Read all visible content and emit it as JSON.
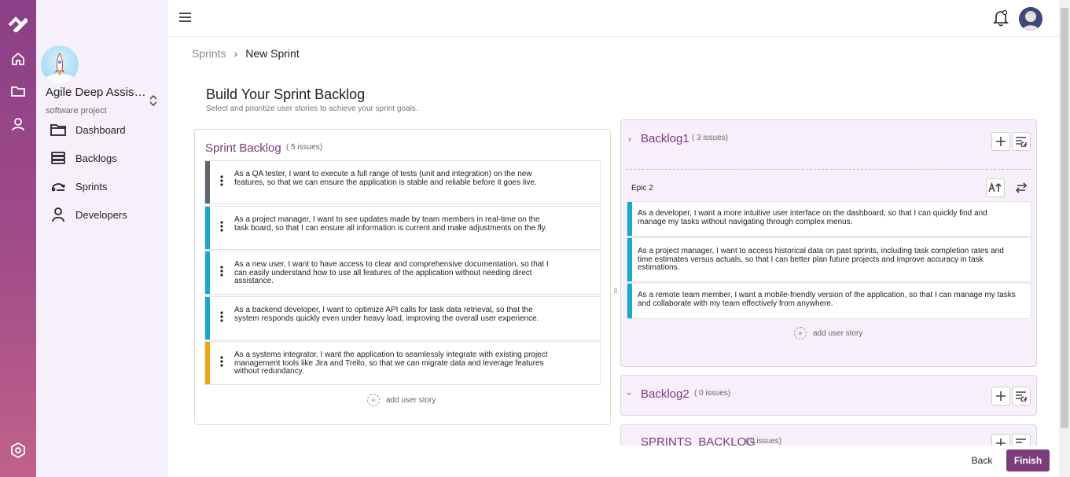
{
  "project": {
    "name": "Agile Deep Assist...",
    "type": "software project"
  },
  "nav": [
    {
      "label": "Dashboard",
      "icon": "folder-icon"
    },
    {
      "label": "Backlogs",
      "icon": "layers-icon"
    },
    {
      "label": "Sprints",
      "icon": "sprint-icon"
    },
    {
      "label": "Developers",
      "icon": "person-icon"
    }
  ],
  "breadcrumb": {
    "parent": "Sprints",
    "current": "New Sprint"
  },
  "page": {
    "title": "Build Your Sprint Backlog",
    "subtitle": "Select and prioritize user stories to achieve your sprint goals."
  },
  "sprint_backlog": {
    "title": "Sprint Backlog",
    "count": "( 5 issues)",
    "add_label": "add user story",
    "stories": [
      {
        "text": "As a QA tester, I want to execute a full range of tests (unit and integration) on the new features, so that we can ensure the application is stable and reliable before it goes live.",
        "color": "#5f6670"
      },
      {
        "text": "As a project manager, I want to see updates made by team members in real-time on the task board, so that I can ensure all information is current and make adjustments on the fly.",
        "color": "#1ba9c9"
      },
      {
        "text": "As a new user, I want to have access to clear and comprehensive documentation, so that I can easily understand how to use all features of the application without needing direct assistance.",
        "color": "#1ba9c9"
      },
      {
        "text": "As a backend developer, I want to optimize API calls for task data retrieval, so that the system responds quickly even under heavy load, improving the overall user experience.",
        "color": "#1ba9c9"
      },
      {
        "text": "As a systems integrator, I want the application to seamlessly integrate with existing project management tools like Jira and Trello, so that we can migrate data and leverage features without redundancy.",
        "color": "#e6a817"
      }
    ]
  },
  "backlogs": [
    {
      "title": "Backlog1",
      "count": "( 3 issues)",
      "epic": "Epic 2",
      "add_label": "add user story",
      "stories": [
        "As a developer, I want a more intuitive user interface on the dashboard, so that I can quickly find and manage my tasks without navigating through complex menus.",
        "As a project manager, I want to access historical data on past sprints, including task completion rates and time estimates versus actuals, so that I can better plan future projects and improve accuracy in task estimations.",
        "As a remote team member, I want a mobile-friendly version of the application, so that I can manage my tasks and collaborate with my team effectively from anywhere."
      ]
    },
    {
      "title": "Backlog2",
      "count": "( 0 issues)"
    },
    {
      "title": "SPRINTS_BACKLOG",
      "count": "( 0 issues)"
    }
  ],
  "actions": {
    "back": "Back",
    "finish": "Finish"
  },
  "colors": {
    "accent": "#7c3b7b",
    "story_cyan": "#1ba9c9",
    "story_gray": "#5f6670",
    "story_amber": "#e6a817"
  }
}
